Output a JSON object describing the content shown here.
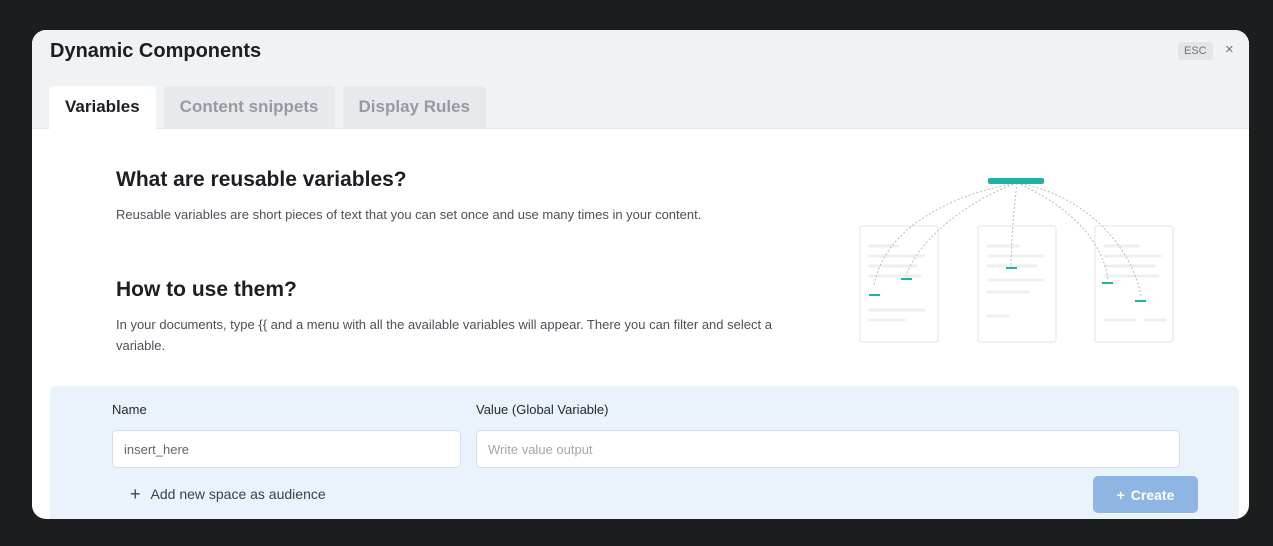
{
  "modal": {
    "title": "Dynamic Components",
    "esc_label": "ESC",
    "close_glyph": "×"
  },
  "tabs": [
    {
      "label": "Variables",
      "active": true
    },
    {
      "label": "Content snippets",
      "active": false
    },
    {
      "label": "Display Rules",
      "active": false
    }
  ],
  "content": {
    "section1": {
      "title": "What are reusable variables?",
      "text": "Reusable variables are short pieces of text that you can set once and use many times in your content."
    },
    "section2": {
      "title": "How to use them?",
      "text": "In your documents, type {{ and a menu with all the available variables will appear. There you can filter and select a variable."
    }
  },
  "form": {
    "name_label": "Name",
    "name_value": "insert_here",
    "value_label": "Value (Global Variable)",
    "value_placeholder": "Write value output",
    "add_label": "Add new space as audience",
    "create_label": "Create",
    "plus_glyph": "+"
  },
  "icons": {
    "close": "close-icon",
    "plus": "plus-icon",
    "illustration": "variables-illustration"
  },
  "colors": {
    "accent": "#1fb3a5",
    "create_button": "#8fb5e3",
    "form_panel": "#eaf2fc"
  }
}
